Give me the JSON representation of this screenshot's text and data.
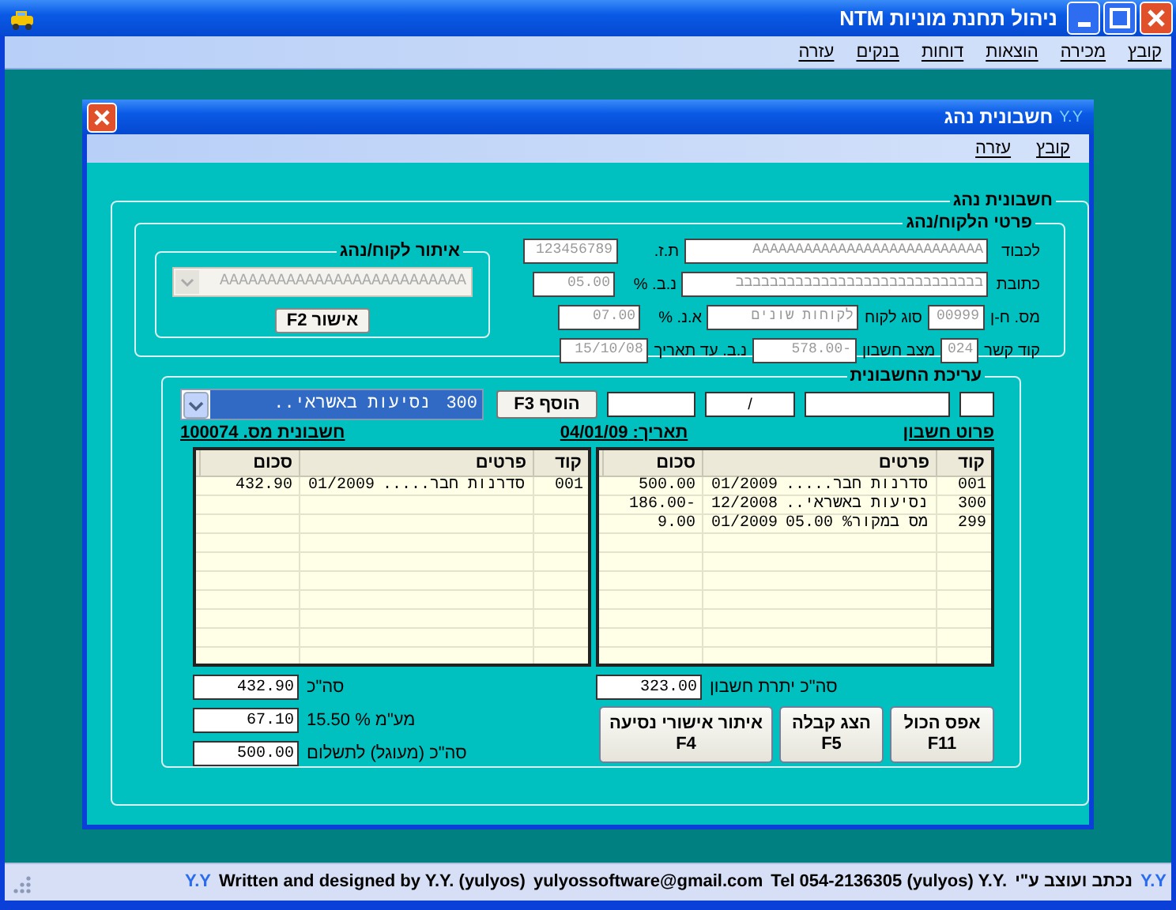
{
  "app_window": {
    "title": "ניהול תחנת מוניות NTM"
  },
  "menu": [
    "קובץ",
    "מכירה",
    "הוצאות",
    "דוחות",
    "בנקים",
    "עזרה"
  ],
  "dialog": {
    "badge": "Y.Y",
    "title": "חשבונית נהג",
    "menu": [
      "קובץ",
      "עזרה"
    ]
  },
  "invoice_group": {
    "title": "חשבונית נהג"
  },
  "customer": {
    "title": "פרטי הלקוח/נהג",
    "read_only": true,
    "rows": [
      [
        {
          "label": "לכבוד",
          "value": "AAAAAAAAAAAAAAAAAAAAAAAAAAA"
        },
        {
          "label": "ת.ז.",
          "value": "123456789"
        }
      ],
      [
        {
          "label": "כתובת",
          "value": "בבבבבבבבבבבבבבבבבבבבבבבבבבבבב"
        },
        {
          "label": "נ.ב. %",
          "value": "05.00"
        }
      ],
      [
        {
          "label": "מס. ח-ן",
          "value": "00999"
        },
        {
          "label": "סוג לקוח",
          "value": "לקוחות שונים"
        },
        {
          "label": "א.נ. %",
          "value": "07.00"
        }
      ],
      [
        {
          "label": "קוד קשר",
          "value": "024"
        },
        {
          "label": "מצב חשבון",
          "value": "578.00-"
        },
        {
          "label": "נ.ב. עד תאריך",
          "value": "15/10/08"
        }
      ]
    ]
  },
  "customer_search": {
    "title": "איתור לקוח/נהג",
    "dropdown": {
      "value": "AAAAAAAAAAAAAAAAAAAAAAAAAA",
      "disabled": true
    },
    "button": "אישור F2"
  },
  "editing": {
    "title": "עריכת החשבונית",
    "entry_fields": [
      {
        "kind": "blank"
      },
      {
        "kind": "blank"
      },
      {
        "kind": "text",
        "value": "/"
      },
      {
        "kind": "blank"
      }
    ],
    "add_button": "הוסף F3",
    "item_select": {
      "code": "300",
      "name": "נסיעות באשראי..",
      "focused": true
    },
    "headings": [
      "פרוט חשבון",
      "תאריך: 04/01/09",
      "חשבונית מס. 100074"
    ],
    "account_table": {
      "columns": [
        "קוד",
        "פרטים",
        "סכום"
      ],
      "rows": [
        {
          "code": "001",
          "details": "סדרנות חבר.....",
          "period": "01/2009",
          "amount": "500.00"
        },
        {
          "code": "300",
          "details": "נסיעות באשראי..",
          "period": "12/2008",
          "amount": "186.00-"
        },
        {
          "code": "299",
          "details": "מס במקור% 05.00",
          "period": "01/2009",
          "amount": "9.00"
        }
      ]
    },
    "invoice_table": {
      "columns": [
        "קוד",
        "פרטים",
        "סכום"
      ],
      "rows": [
        {
          "code": "001",
          "details": "סדרנות חבר.....",
          "period": "01/2009",
          "amount": "432.90"
        }
      ]
    },
    "account_balance": {
      "label": "סה\"כ יתרת חשבון",
      "value": "323.00"
    },
    "totals": [
      {
        "label": "סה\"כ",
        "value": "432.90"
      },
      {
        "label": "מע\"מ % 15.50",
        "value": "67.10"
      },
      {
        "label": "סה\"כ (מעוגל) לתשלום",
        "value": "500.00"
      }
    ],
    "buttons": [
      {
        "label": "אפס הכול",
        "key": "F11"
      },
      {
        "label": "הצג קבלה",
        "key": "F5"
      },
      {
        "label": "איתור אישורי נסיעה",
        "key": "F4"
      }
    ]
  },
  "status_bar": {
    "items": [
      {
        "kind": "logo",
        "text": "Y.Y"
      },
      {
        "kind": "text",
        "text": "נכתב ועוצב ע\"י"
      },
      {
        "kind": "text",
        "text": "Tel 054-2136305 (yulyos) Y.Y."
      },
      {
        "kind": "text",
        "text": "yulyossoftware@gmail.com"
      },
      {
        "kind": "text",
        "text": "Written and designed by Y.Y. (yulyos)"
      },
      {
        "kind": "logo",
        "text": "Y.Y"
      }
    ]
  }
}
